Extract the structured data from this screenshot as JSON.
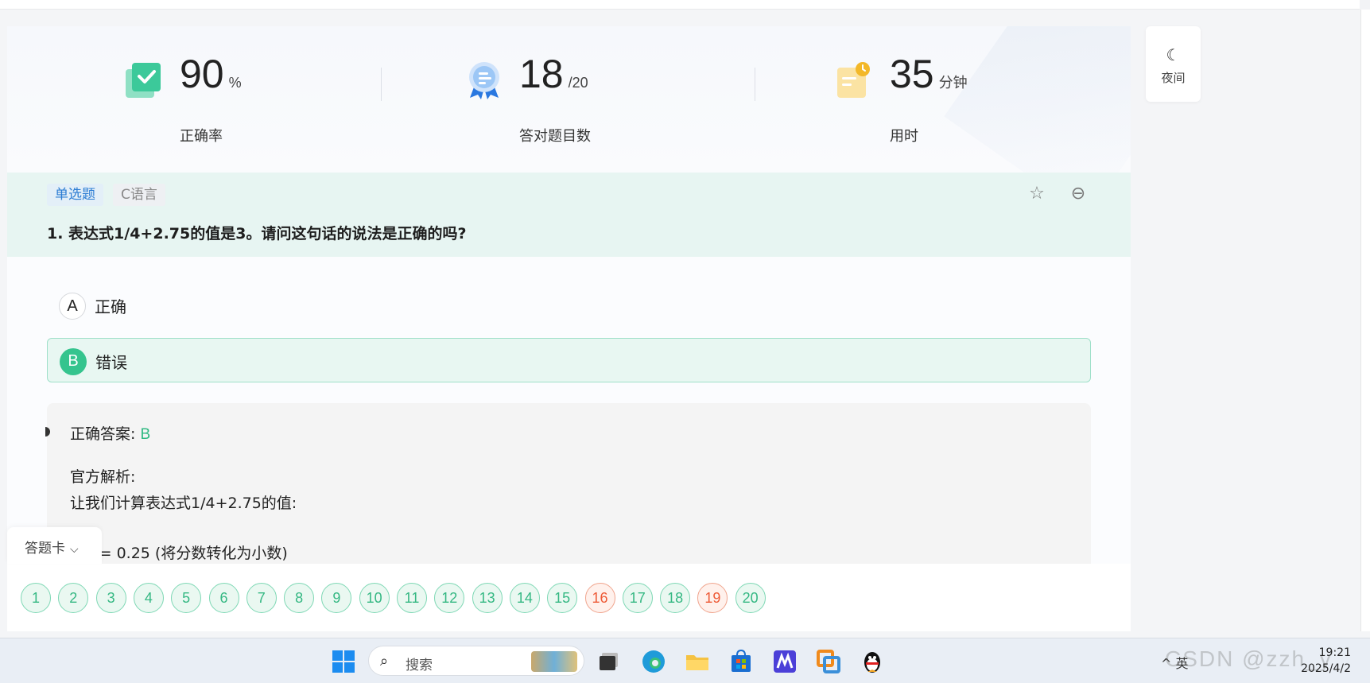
{
  "stats": {
    "accuracy": {
      "value": "90",
      "unit": "%",
      "label": "正确率"
    },
    "correct": {
      "value": "18",
      "unit": "/20",
      "label": "答对题目数"
    },
    "time": {
      "value": "35",
      "unit": "分钟",
      "label": "用时"
    }
  },
  "night_mode": {
    "label": "夜间"
  },
  "question": {
    "type_tag": "单选题",
    "lang_tag": "C语言",
    "title": "1. 表达式1/4+2.75的值是3。请问这句话的说法是正确的吗?",
    "options": [
      {
        "letter": "A",
        "text": "正确"
      },
      {
        "letter": "B",
        "text": "错误"
      }
    ]
  },
  "explanation": {
    "answer_label": "正确答案:",
    "answer_value": "B",
    "heading": "官方解析:",
    "line1": "让我们计算表达式1/4+2.75的值:",
    "line2": "1/4 = 0.25 (将分数转化为小数)"
  },
  "answer_card": {
    "toggle_label": "答题卡",
    "numbers": [
      "1",
      "2",
      "3",
      "4",
      "5",
      "6",
      "7",
      "8",
      "9",
      "10",
      "11",
      "12",
      "13",
      "14",
      "15",
      "16",
      "17",
      "18",
      "19",
      "20"
    ],
    "wrong": [
      "16",
      "19"
    ]
  },
  "taskbar": {
    "search_placeholder": "搜索",
    "time": "19:21",
    "date": "2025/4/2",
    "tray_text": "^ 英",
    "watermark": "CSDN @zzh_y"
  },
  "colors": {
    "accent_green": "#35c48e",
    "wrong_red": "#ee5a36",
    "tag_blue": "#2b7cd3"
  }
}
